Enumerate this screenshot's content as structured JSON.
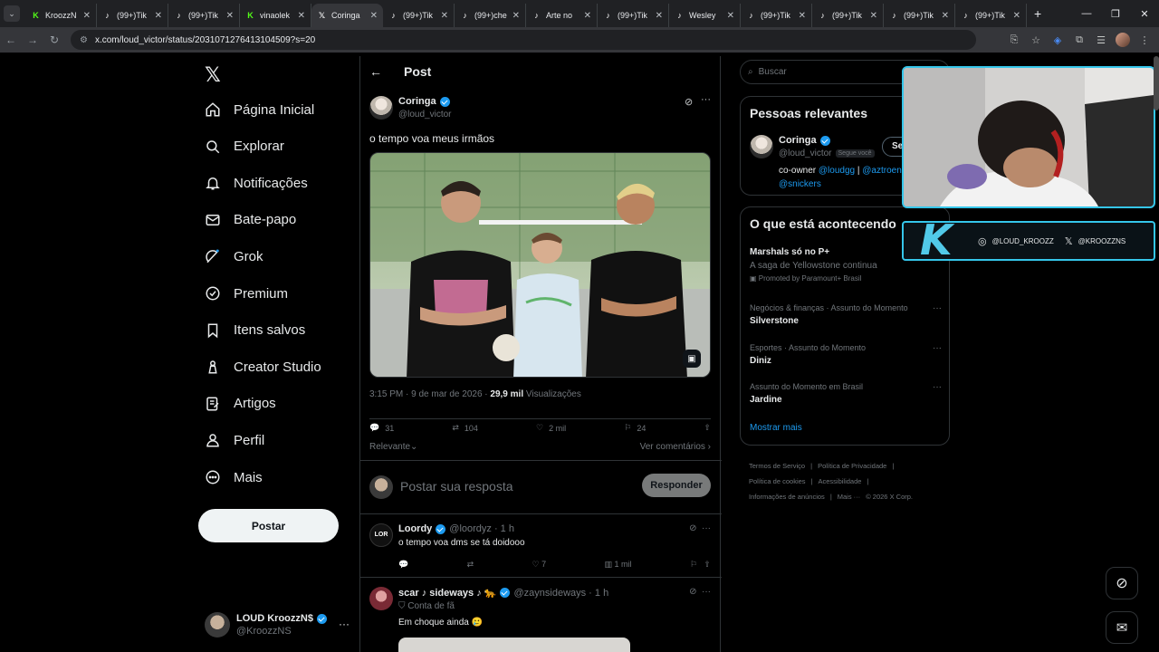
{
  "browser": {
    "tabs": [
      {
        "label": "KroozzN",
        "fav": "K",
        "favcolor": "#53fc18"
      },
      {
        "label": "(99+)Tik",
        "fav": "♪",
        "favcolor": "#ffffff"
      },
      {
        "label": "(99+)Tik",
        "fav": "♪",
        "favcolor": "#ffffff"
      },
      {
        "label": "vinaolek",
        "fav": "K",
        "favcolor": "#53fc18"
      },
      {
        "label": "Coringa",
        "fav": "𝕏",
        "favcolor": "#ffffff"
      },
      {
        "label": "(99+)Tik",
        "fav": "♪",
        "favcolor": "#ffffff"
      },
      {
        "label": "(99+)che",
        "fav": "♪",
        "favcolor": "#ffffff"
      },
      {
        "label": "Arte no",
        "fav": "♪",
        "favcolor": "#ffffff"
      },
      {
        "label": "(99+)Tik",
        "fav": "♪",
        "favcolor": "#ffffff"
      },
      {
        "label": "Wesley",
        "fav": "♪",
        "favcolor": "#ffffff"
      },
      {
        "label": "(99+)Tik",
        "fav": "♪",
        "favcolor": "#ffffff"
      },
      {
        "label": "(99+)Tik",
        "fav": "♪",
        "favcolor": "#ffffff"
      },
      {
        "label": "(99+)Tik",
        "fav": "♪",
        "favcolor": "#ffffff"
      },
      {
        "label": "(99+)Tik",
        "fav": "♪",
        "favcolor": "#ffffff"
      }
    ],
    "active_tab": 4,
    "url": "x.com/loud_victor/status/2031071276413104509?s=20"
  },
  "nav": {
    "items": [
      {
        "label": "Página Inicial",
        "icon": "home-icon"
      },
      {
        "label": "Explorar",
        "icon": "search-icon"
      },
      {
        "label": "Notificações",
        "icon": "bell-icon"
      },
      {
        "label": "Bate-papo",
        "icon": "mail-icon"
      },
      {
        "label": "Grok",
        "icon": "grok-icon"
      },
      {
        "label": "Premium",
        "icon": "premium-icon"
      },
      {
        "label": "Itens salvos",
        "icon": "bookmark-icon"
      },
      {
        "label": "Creator Studio",
        "icon": "creator-icon"
      },
      {
        "label": "Artigos",
        "icon": "articles-icon"
      },
      {
        "label": "Perfil",
        "icon": "profile-icon"
      },
      {
        "label": "Mais",
        "icon": "more-icon"
      }
    ],
    "post_button": "Postar",
    "account": {
      "name": "LOUD KroozzN$",
      "handle": "@KroozzNS"
    }
  },
  "post": {
    "header": "Post",
    "author_name": "Coringa",
    "author_handle": "@loud_victor",
    "text": "o tempo voa meus irmãos",
    "time": "3:15 PM · 9 de mar de 2026 · ",
    "views": "29,9 mil",
    "views_label": " Visualizações",
    "replies": "31",
    "reposts": "104",
    "likes": "2 mil",
    "bookmarks": "24",
    "sort": "Relevante",
    "see_comments": "Ver comentários"
  },
  "reply_box": {
    "placeholder": "Postar sua resposta",
    "button": "Responder"
  },
  "replies": [
    {
      "name": "Loordy",
      "handle": "@loordyz · 1 h",
      "text": "o tempo voa dms se tá doidooo",
      "likes": "7",
      "views": "1 mil"
    },
    {
      "name": "scar ♪ sideways ♪ 🐆",
      "handle": "@zaynsideways · 1 h",
      "badge": "Conta de fã",
      "text": "Em choque ainda 🥲"
    }
  ],
  "right": {
    "search_placeholder": "Buscar",
    "relevant_title": "Pessoas relevantes",
    "relevant_person": {
      "name": "Coringa",
      "handle": "@loud_victor",
      "follows_you": "Segue você",
      "follow_btn": "Se",
      "bio_prefix": "co-owner ",
      "bio_link1": "@loudgg",
      "bio_sep": " | ",
      "bio_link2": "@aztroen",
      "bio_link3": "@snickers"
    },
    "trends_title": "O que está acontecendo",
    "promo": {
      "title": "Marshals só no P+",
      "desc": "A saga de Yellowstone continua",
      "by": "Promoted by Paramount+ Brasil"
    },
    "trends": [
      {
        "context": "Negócios & finanças · Assunto do Momento",
        "title": "Silverstone"
      },
      {
        "context": "Esportes · Assunto do Momento",
        "title": "Diniz"
      },
      {
        "context": "Assunto do Momento em Brasil",
        "title": "Jardine"
      }
    ],
    "show_more": "Mostrar mais",
    "footer": [
      "Termos de Serviço",
      "|",
      "Política de Privacidade",
      "|",
      "Política de cookies",
      "|",
      "Acessibilidade",
      "|",
      "Informações de anúncios",
      "|",
      "Mais ···",
      "© 2026 X Corp."
    ]
  },
  "overlay": {
    "instagram": "@LOUD_KROOZZ",
    "x_handle": "@KROOZZNS",
    "k_logo": "K"
  },
  "colors": {
    "accent": "#1d9bf0",
    "overlay": "#35c6ea",
    "kick": "#53fc18"
  }
}
